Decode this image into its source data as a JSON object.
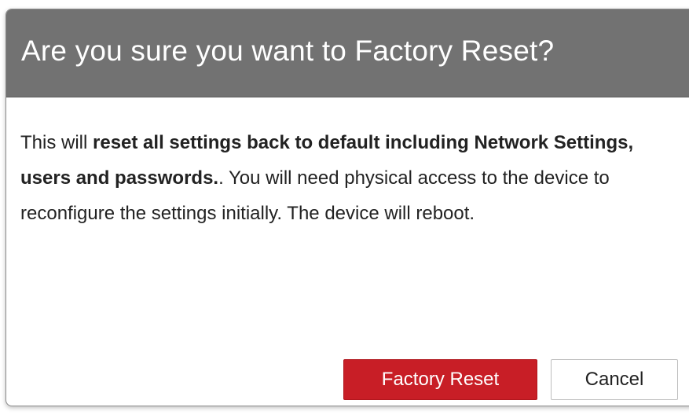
{
  "dialog": {
    "title": "Are you sure you want to Factory Reset?",
    "message": {
      "intro": "This will ",
      "emphasis": "reset all settings back to default including Network Settings, users and passwords.",
      "rest": ". You will need physical access to the device to reconfigure the settings initially. The device will reboot."
    },
    "buttons": {
      "confirm_label": "Factory Reset",
      "cancel_label": "Cancel"
    }
  },
  "colors": {
    "header_bg": "#727272",
    "confirm_bg": "#c81e26",
    "text": "#222222"
  }
}
